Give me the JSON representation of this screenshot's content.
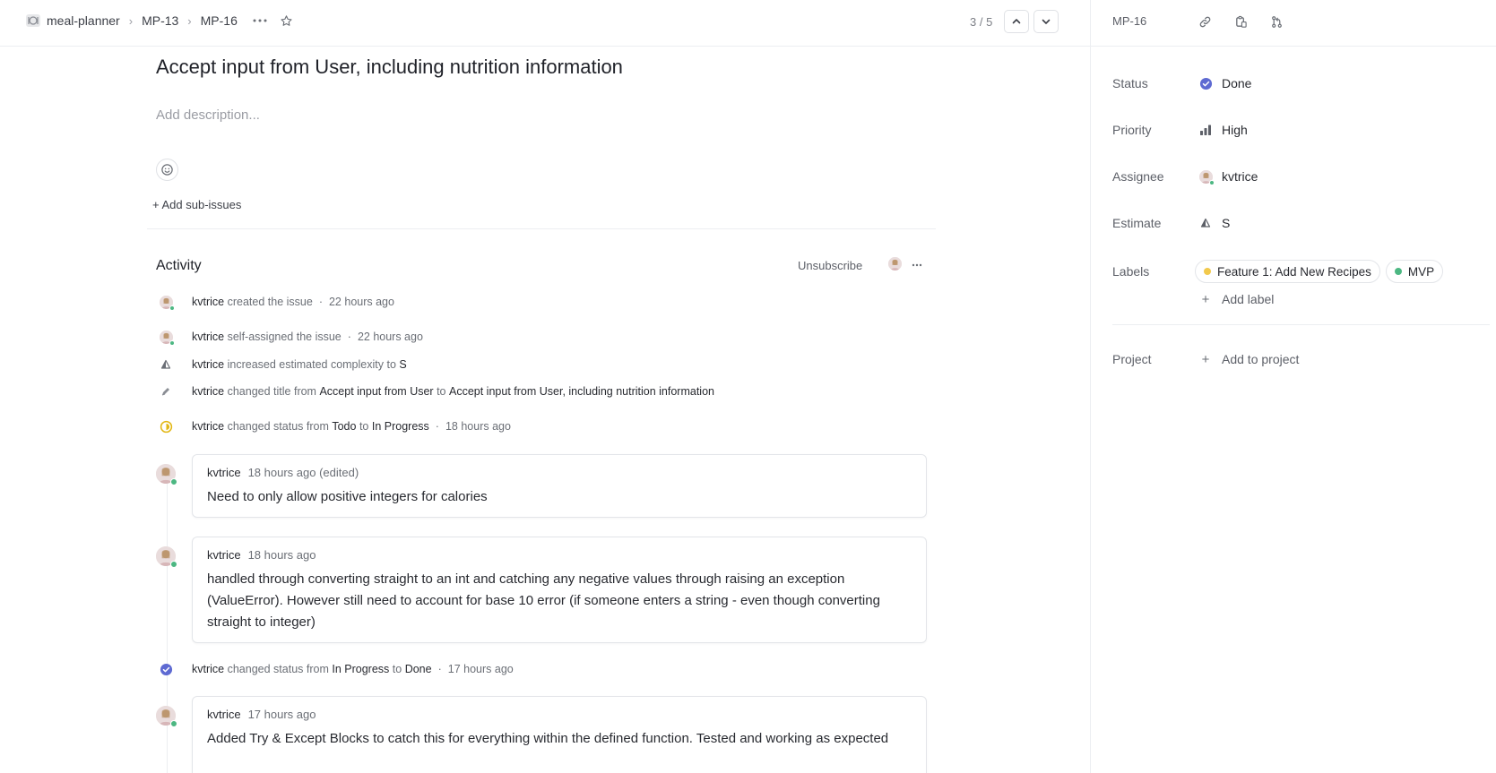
{
  "breadcrumb": {
    "team": "meal-planner",
    "parent": "MP-13",
    "current": "MP-16"
  },
  "pager": {
    "text": "3 / 5"
  },
  "issue": {
    "title": "Accept input from User, including nutrition information",
    "description_placeholder": "Add description...",
    "add_sub_issues": "+ Add sub-issues"
  },
  "activity": {
    "title": "Activity",
    "unsubscribe": "Unsubscribe",
    "events": [
      {
        "user": "kvtrice",
        "action": "created the issue",
        "time": "22 hours ago"
      },
      {
        "user": "kvtrice",
        "action": "self-assigned the issue",
        "time": "22 hours ago"
      },
      {
        "user": "kvtrice",
        "action": "increased estimated complexity to",
        "value": "S"
      },
      {
        "user": "kvtrice",
        "action": "changed title from",
        "from": "Accept input from User",
        "to_word": "to",
        "to": "Accept input from User, including nutrition information"
      },
      {
        "user": "kvtrice",
        "action": "changed status from",
        "from": "Todo",
        "to_word": "to",
        "to": "In Progress",
        "time": "18 hours ago"
      },
      {
        "user": "kvtrice",
        "action": "changed status from",
        "from": "In Progress",
        "to_word": "to",
        "to": "Done",
        "time": "17 hours ago"
      }
    ],
    "comments": [
      {
        "author": "kvtrice",
        "time": "18 hours ago (edited)",
        "body": "Need to only allow positive integers for calories"
      },
      {
        "author": "kvtrice",
        "time": "18 hours ago",
        "body": "handled through converting straight to an int and catching any negative values through raising an exception (ValueError). However still need to account for base 10 error (if someone enters a string - even though converting straight to integer)"
      },
      {
        "author": "kvtrice",
        "time": "17 hours ago",
        "body": "Added Try & Except Blocks to catch this for everything within the defined function. Tested and working as expected"
      }
    ]
  },
  "sidebar": {
    "id": "MP-16",
    "status": {
      "label": "Status",
      "value": "Done"
    },
    "priority": {
      "label": "Priority",
      "value": "High"
    },
    "assignee": {
      "label": "Assignee",
      "value": "kvtrice"
    },
    "estimate": {
      "label": "Estimate",
      "value": "S"
    },
    "labels": {
      "label": "Labels",
      "items": [
        {
          "name": "Feature 1: Add New Recipes",
          "color": "#f2c94c"
        },
        {
          "name": "MVP",
          "color": "#4cb782"
        }
      ],
      "add": "Add label"
    },
    "project": {
      "label": "Project",
      "add": "Add to project"
    }
  },
  "colors": {
    "done": "#5e6ad2",
    "in_progress": "#f2c94c",
    "online": "#4cb782"
  }
}
